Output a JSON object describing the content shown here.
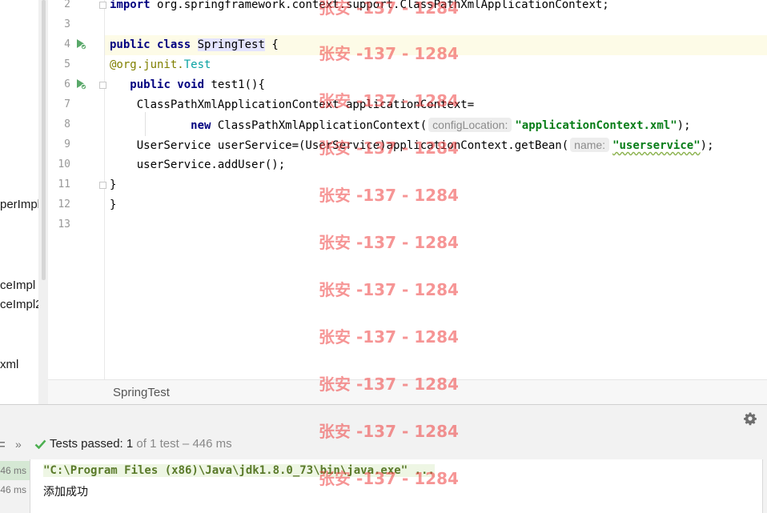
{
  "project_tree": {
    "items": [
      "perImpl",
      "ceImpl",
      "ceImpl2",
      "xml"
    ]
  },
  "editor": {
    "line_numbers": [
      "2",
      "3",
      "4",
      "5",
      "6",
      "7",
      "8",
      "9",
      "10",
      "11",
      "12",
      "13"
    ],
    "lines": {
      "l2": {
        "kw": "import",
        "rest": " org.springframework.context.support.ClassPathXmlApplicationContext;"
      },
      "l4": {
        "kw": "public class",
        "space": " ",
        "cls": "SpringTest",
        "rest": " {"
      },
      "l5": {
        "at": "@org.junit.",
        "ann": "Test"
      },
      "l6": {
        "indent": "   ",
        "kw": "public void",
        "rest": " test1(){"
      },
      "l7": {
        "text": "    ClassPathXmlApplicationContext applicationContext="
      },
      "l8": {
        "indent": "            ",
        "kw": "new",
        "rest": " ClassPathXmlApplicationContext(",
        "hint": "configLocation:",
        "str": "\"applicationContext.xml\"",
        "end": ");"
      },
      "l9": {
        "text": "    UserService userService=(UserService)applicationContext.getBean(",
        "hint": "name:",
        "str": "\"userservice\"",
        "end": ");"
      },
      "l10": {
        "text": "    userService.addUser();"
      },
      "l11": {
        "text": "}"
      },
      "l12": {
        "text": "}"
      }
    }
  },
  "breadcrumb": {
    "label": "SpringTest"
  },
  "run_panel": {
    "chevrons": "»",
    "status_pass": "Tests passed: ",
    "status_count": "1",
    "status_rest": " of 1 test – 446 ms",
    "times": [
      "46 ms",
      "46 ms"
    ],
    "console_cmd": "\"C:\\Program Files (x86)\\Java\\jdk1.8.0_73\\bin\\java.exe\" ...",
    "console_output": "添加成功"
  },
  "watermark": {
    "text": "张安 -137 - 1284"
  },
  "colors": {
    "keyword": "#000080",
    "string": "#067d17",
    "pass_green": "#4caf50",
    "watermark": "#f04040"
  }
}
